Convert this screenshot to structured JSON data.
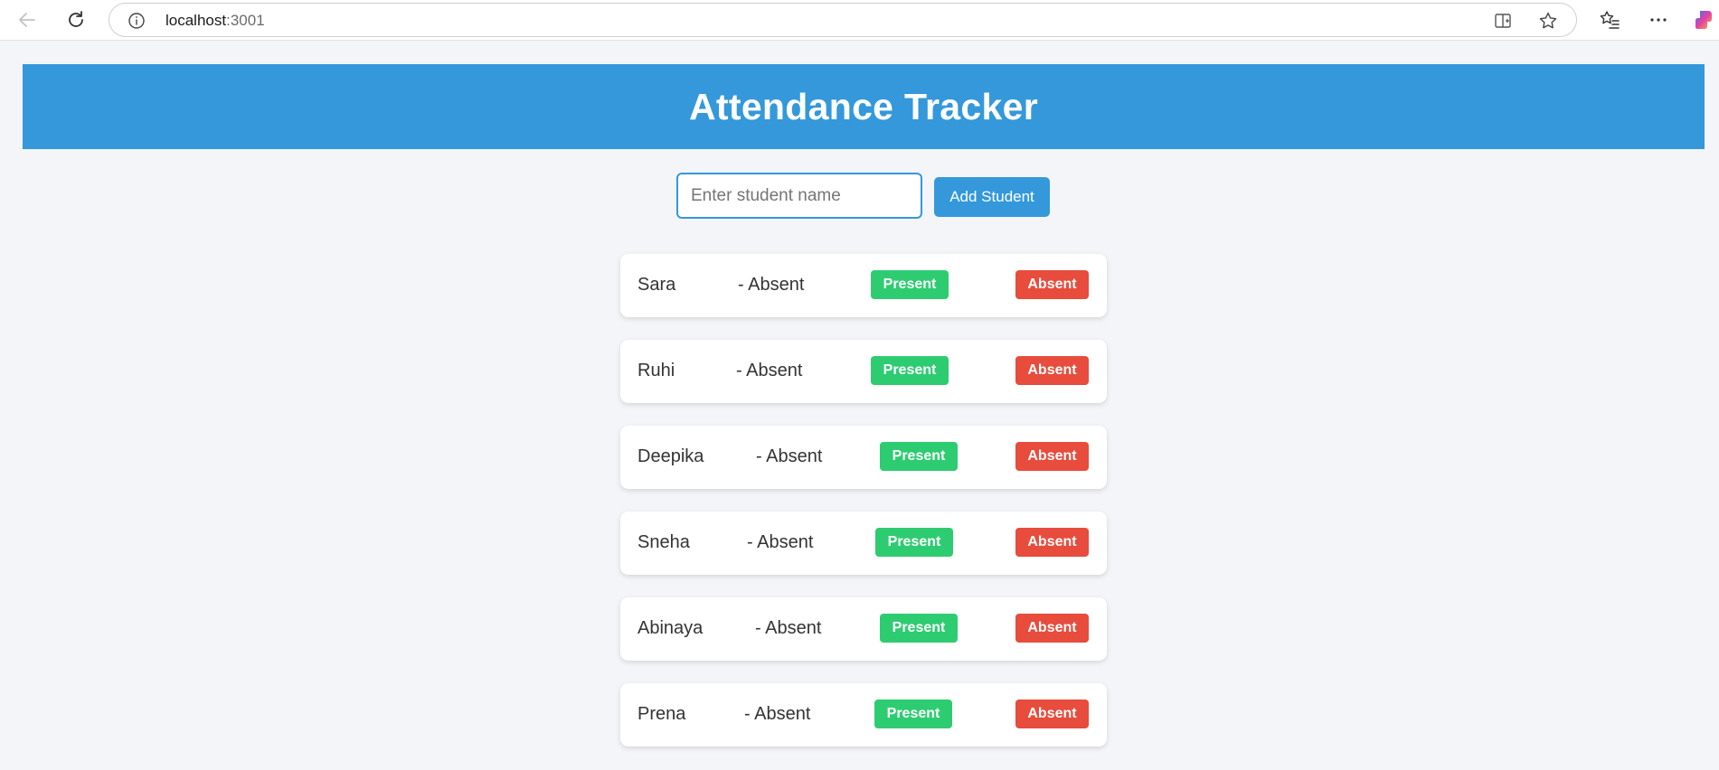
{
  "browser": {
    "url_host": "localhost",
    "url_port": ":3001"
  },
  "header": {
    "title": "Attendance Tracker"
  },
  "form": {
    "placeholder": "Enter student name",
    "value": "",
    "add_label": "Add Student"
  },
  "students": [
    {
      "name": "Sara",
      "status": "- Absent",
      "present_label": "Present",
      "absent_label": "Absent"
    },
    {
      "name": "Ruhi",
      "status": "- Absent",
      "present_label": "Present",
      "absent_label": "Absent"
    },
    {
      "name": "Deepika",
      "status": "- Absent",
      "present_label": "Present",
      "absent_label": "Absent"
    },
    {
      "name": "Sneha",
      "status": "- Absent",
      "present_label": "Present",
      "absent_label": "Absent"
    },
    {
      "name": "Abinaya",
      "status": "- Absent",
      "present_label": "Present",
      "absent_label": "Absent"
    },
    {
      "name": "Prena",
      "status": "- Absent",
      "present_label": "Present",
      "absent_label": "Absent"
    }
  ],
  "colors": {
    "accent": "#3498db",
    "present": "#2ecc71",
    "absent": "#e74c3c",
    "page_bg": "#f4f5f8"
  }
}
